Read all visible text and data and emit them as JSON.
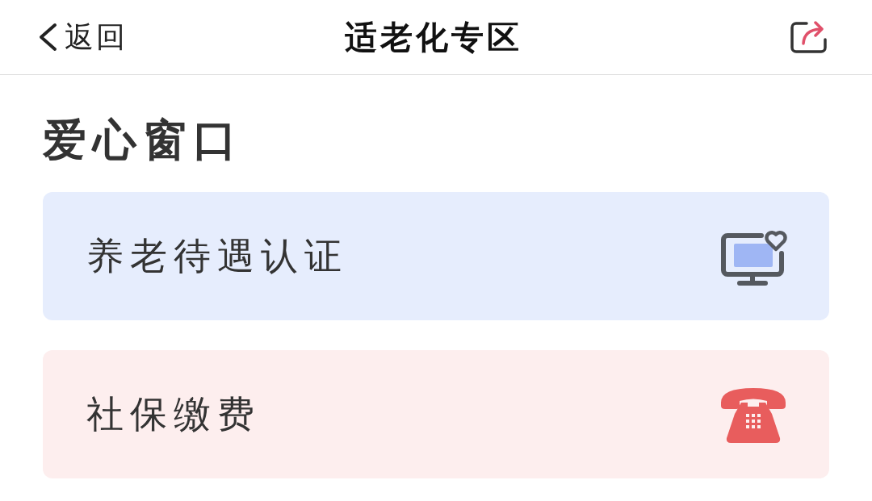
{
  "header": {
    "back_label": "返回",
    "title": "适老化专区"
  },
  "section": {
    "title": "爱心窗口",
    "items": [
      {
        "label": "养老待遇认证",
        "kind": "monitor",
        "color": "#e6edfd"
      },
      {
        "label": "社保缴费",
        "kind": "phone",
        "color": "#fdeeee"
      }
    ]
  }
}
